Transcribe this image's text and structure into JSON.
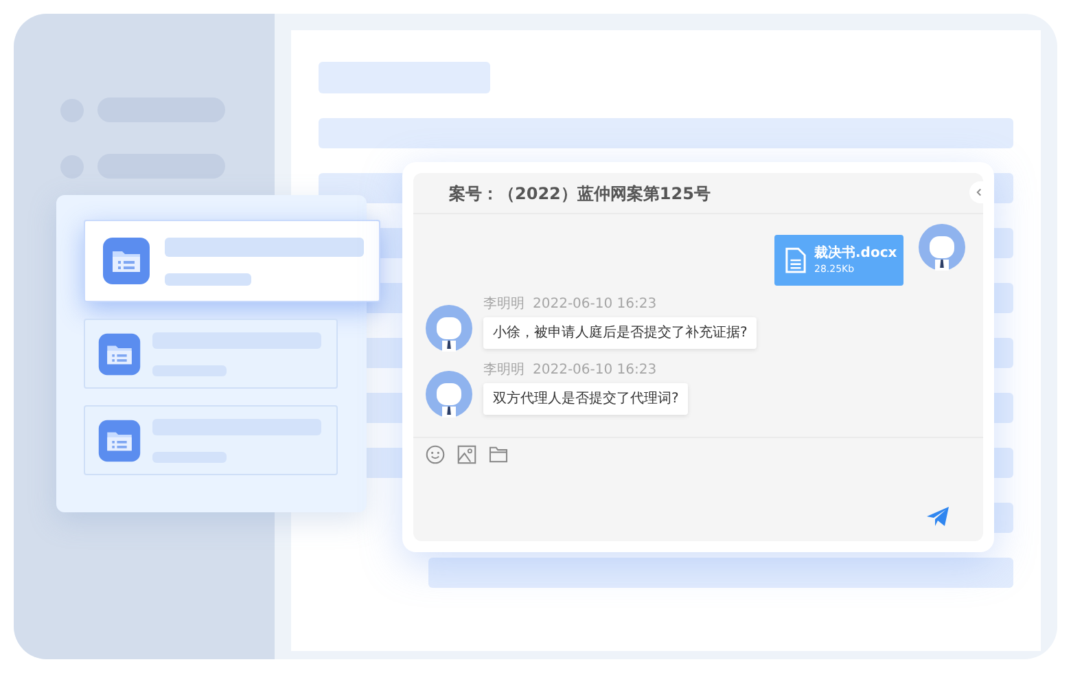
{
  "case_list": {
    "items": [
      {
        "selected": true
      },
      {
        "selected": false
      },
      {
        "selected": false
      }
    ]
  },
  "chat": {
    "title": "案号：（2022）蓝仲网案第125号",
    "messages": [
      {
        "kind": "file",
        "file_name": "裁决书.docx",
        "file_size": "28.25Kb"
      },
      {
        "kind": "text",
        "sender": "李明明",
        "time": "2022-06-10 16:23",
        "text": "小徐，被申请人庭后是否提交了补充证据?"
      },
      {
        "kind": "text",
        "sender": "李明明",
        "time": "2022-06-10 16:23",
        "text": "双方代理人是否提交了代理词?"
      }
    ]
  }
}
